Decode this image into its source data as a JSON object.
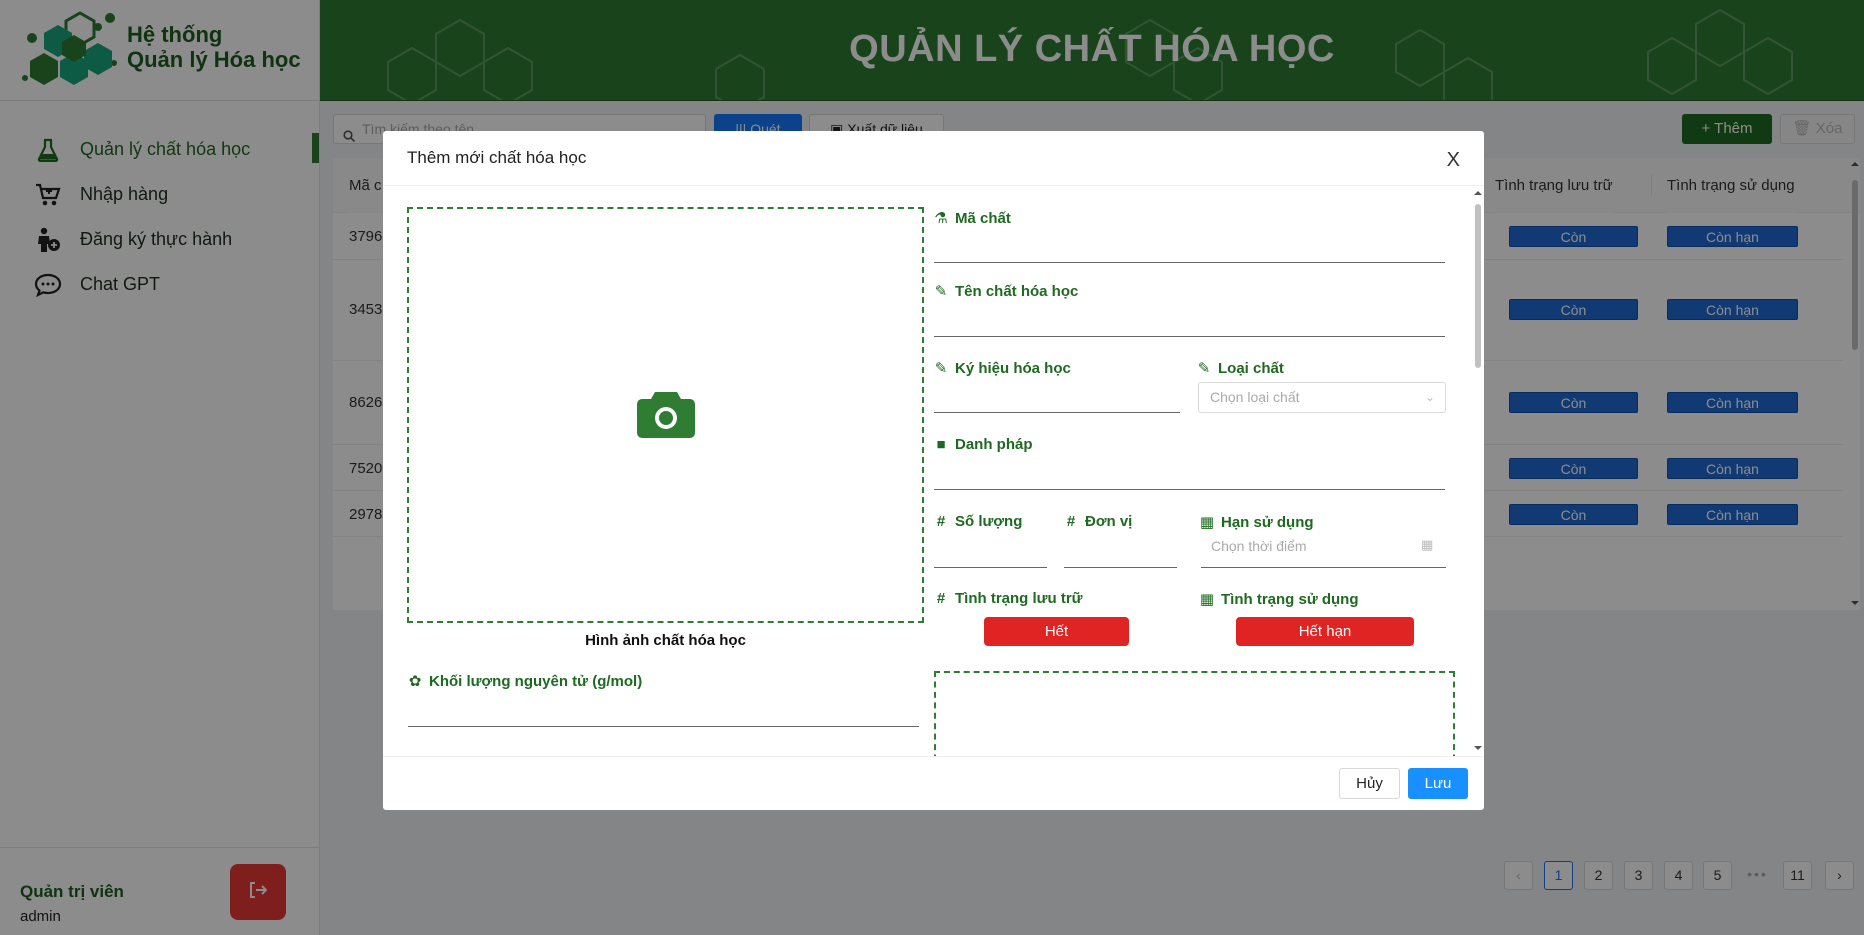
{
  "app": {
    "brand_line1": "Hệ thống",
    "brand_line2": "Quản lý Hóa học",
    "header_title": "QUẢN LÝ CHẤT HÓA HỌC",
    "brand_color": "#2e7d32"
  },
  "sidebar": {
    "items": [
      {
        "label": "Quản lý chất hóa học",
        "icon": "flask-icon",
        "active": true
      },
      {
        "label": "Nhập hàng",
        "icon": "cart-icon",
        "active": false
      },
      {
        "label": "Đăng ký thực hành",
        "icon": "person-add-icon",
        "active": false
      },
      {
        "label": "Chat GPT",
        "icon": "chat-icon",
        "active": false
      }
    ],
    "user_role": "Quản trị viên",
    "user_name": "admin"
  },
  "toolbar": {
    "search_placeholder": "Tìm kiếm theo tên",
    "scan_label": "Quét",
    "export_label": "Xuất dữ liệu",
    "add_label": "Thêm",
    "delete_label": "Xóa"
  },
  "table": {
    "col_code": "Mã c",
    "col_storage": "Tình trạng lưu trữ",
    "col_usage": "Tình trạng sử dụng",
    "rows": [
      {
        "id": "3796",
        "storage": "Còn",
        "usage": "Còn hạn"
      },
      {
        "id": "3453",
        "storage": "Còn",
        "usage": "Còn hạn"
      },
      {
        "id": "8626",
        "storage": "Còn",
        "usage": "Còn hạn"
      },
      {
        "id": "7520",
        "storage": "Còn",
        "usage": "Còn hạn"
      },
      {
        "id": "2978",
        "storage": "Còn",
        "usage": "Còn hạn"
      }
    ]
  },
  "pagination": {
    "pages": [
      "1",
      "2",
      "3",
      "4",
      "5",
      "11"
    ],
    "current": "1",
    "ellipsis": "•••",
    "prev": "‹",
    "next": "›"
  },
  "modal": {
    "title": "Thêm mới chất hóa học",
    "close": "X",
    "image_caption": "Hình ảnh chất hóa học",
    "fields": {
      "code": "Mã chất",
      "name": "Tên chất hóa học",
      "symbol": "Ký hiệu hóa học",
      "type": "Loại chất",
      "type_placeholder": "Chọn loại chất",
      "nomenclature": "Danh pháp",
      "quantity": "Số lượng",
      "unit": "Đơn vị",
      "expiry": "Hạn sử dụng",
      "expiry_placeholder": "Chọn thời điểm",
      "storage_status": "Tình trạng lưu trữ",
      "usage_status": "Tình trạng sử dụng",
      "storage_value": "Hết",
      "usage_value": "Hết hạn",
      "atomic_mass": "Khối lượng nguyên tử (g/mol)"
    },
    "cancel": "Hủy",
    "save": "Lưu"
  }
}
